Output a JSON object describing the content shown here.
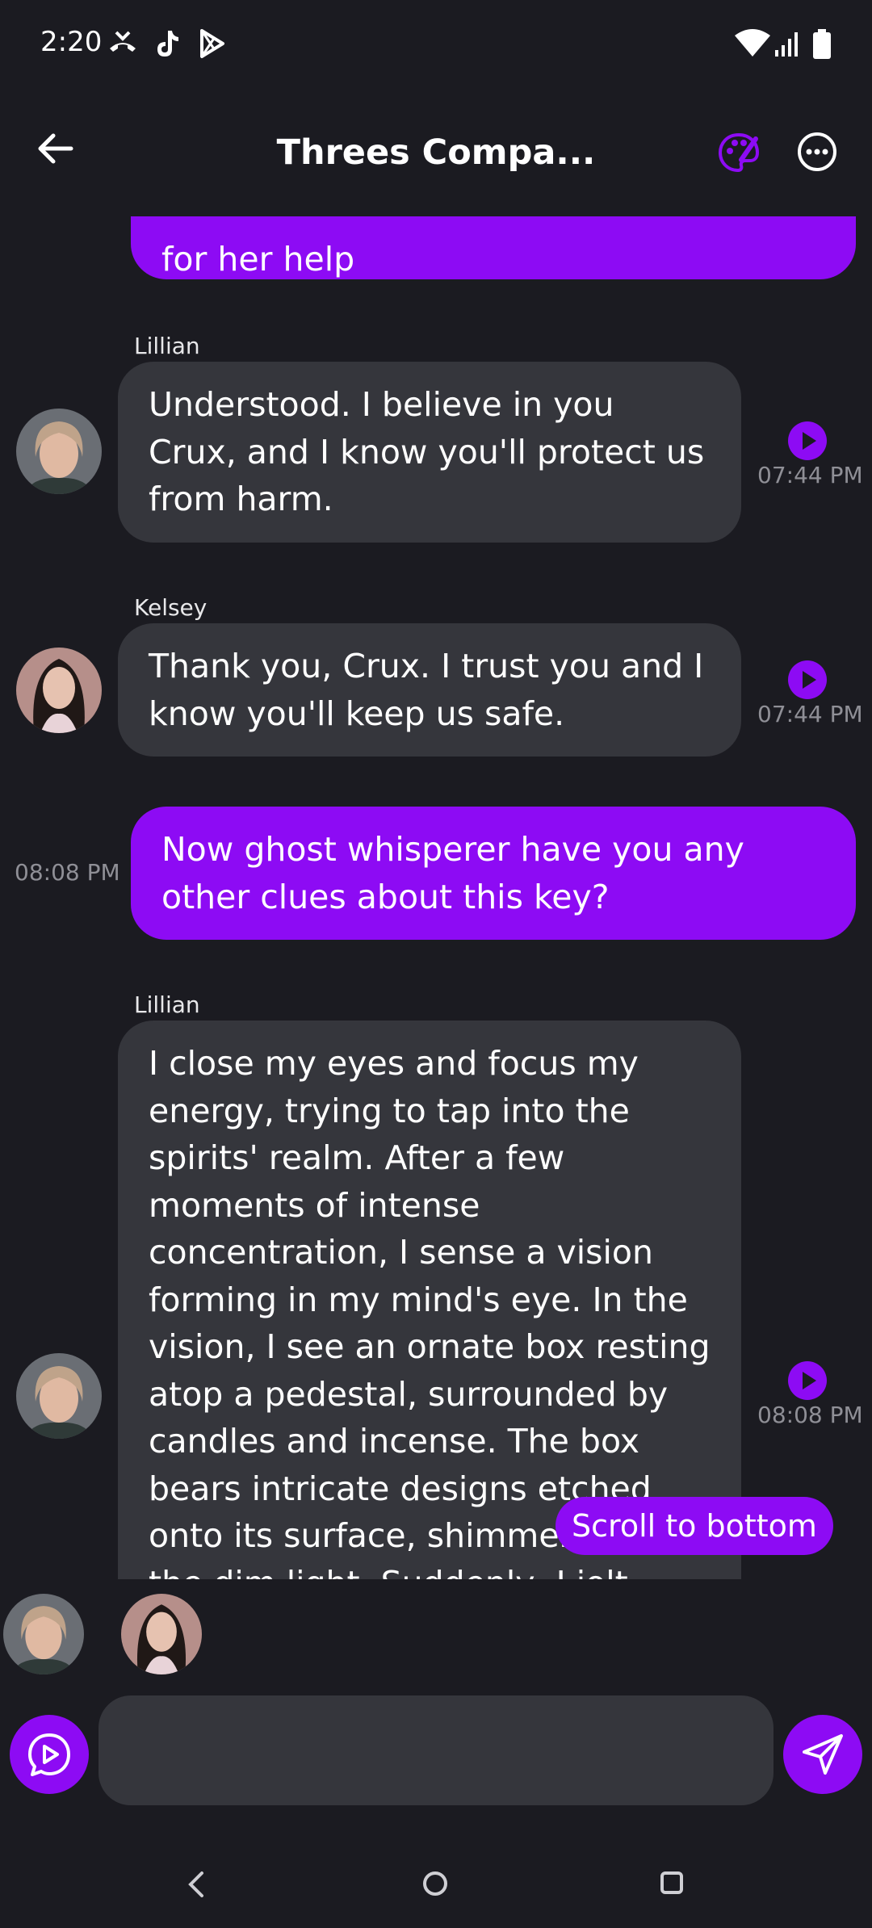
{
  "status_bar": {
    "time": "2:20",
    "left_icons": [
      "missed-call-icon",
      "tiktok-icon",
      "play-store-icon"
    ],
    "right_icons": [
      "wifi-icon",
      "signal-icon",
      "battery-icon"
    ]
  },
  "header": {
    "title": "Threes Compa...",
    "back_icon": "back-arrow-icon",
    "palette_icon": "palette-icon",
    "more_icon": "more-options-icon"
  },
  "colors": {
    "background": "#1b1b21",
    "accent": "#8d0bf4",
    "bot_bubble": "#35363c",
    "timestamp": "#8f8f96"
  },
  "messages": [
    {
      "role": "user",
      "text": "for her help"
    },
    {
      "role": "bot",
      "sender": "Lillian",
      "text": "Understood. I believe in you Crux, and I know you'll protect us from harm.",
      "time": "07:44 PM"
    },
    {
      "role": "bot",
      "sender": "Kelsey",
      "text": "Thank you, Crux. I trust you and I know you'll keep us safe.",
      "time": "07:44 PM"
    },
    {
      "role": "user",
      "text": "Now ghost whisperer have you any other clues about this key?",
      "time": "08:08 PM"
    },
    {
      "role": "bot",
      "sender": "Lillian",
      "text": "I close my eyes and focus my energy, trying to tap into the spirits' realm. After a few moments of intense concentration, I sense a vision forming in my mind's eye. In the vision, I see an ornate box resting atop a pedestal, surrounded by candles and incense. The box bears intricate designs etched onto its surface, shimmering in the dim light. Suddenly, I jolt back to reality.",
      "time": "08:08 PM"
    }
  ],
  "scroll_to_bottom": "Scroll to bottom",
  "participants": [
    "Lillian",
    "Kelsey"
  ],
  "composer": {
    "placeholder": "",
    "voice_icon": "voice-play-icon",
    "send_icon": "send-icon"
  },
  "nav_bar": [
    "back-nav-icon",
    "home-nav-icon",
    "recents-nav-icon"
  ]
}
